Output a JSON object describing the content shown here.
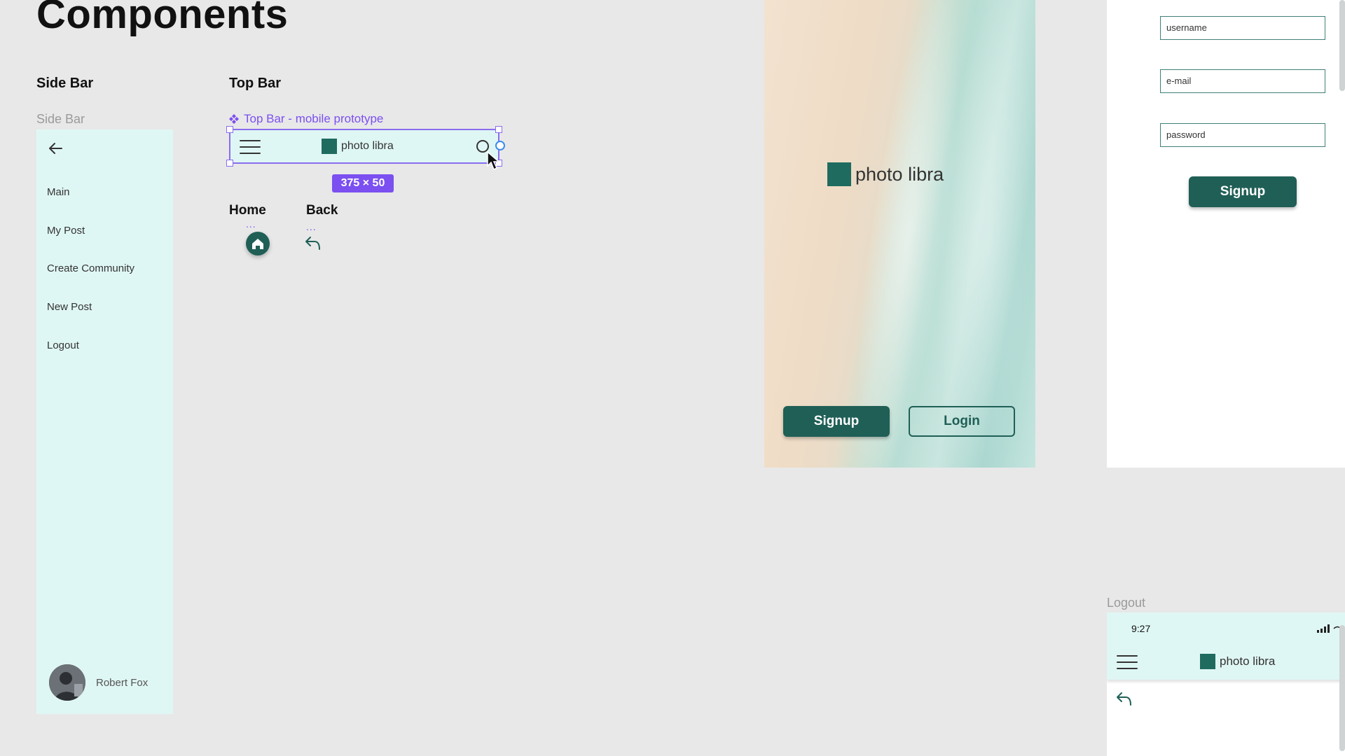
{
  "page": {
    "title": "Components"
  },
  "sections": {
    "side_bar": "Side Bar",
    "top_bar": "Top Bar"
  },
  "sidebar": {
    "frame_label": "Side Bar",
    "items": [
      {
        "label": "Main"
      },
      {
        "label": "My Post"
      },
      {
        "label": "Create Community"
      },
      {
        "label": "New Post"
      },
      {
        "label": "Logout"
      }
    ],
    "user": {
      "name": "Robert Fox"
    }
  },
  "topbar": {
    "component_label": "Top Bar - mobile prototype",
    "brand": "photo libra",
    "size_badge": "375 × 50"
  },
  "icons": {
    "home_label": "Home",
    "back_label": "Back",
    "dots": "..."
  },
  "welcome": {
    "brand": "photo libra",
    "signup_label": "Signup",
    "login_label": "Login"
  },
  "signup_form": {
    "username_placeholder": "username",
    "email_placeholder": "e-mail",
    "password_placeholder": "password",
    "signup_label": "Signup"
  },
  "logout": {
    "frame_label": "Logout",
    "time": "9:27",
    "brand": "photo libra"
  },
  "colors": {
    "primary": "#1f5f56",
    "sidebar_bg": "#dff7f4",
    "selection": "#7b4ff0",
    "canvas": "#e8e8e8"
  }
}
